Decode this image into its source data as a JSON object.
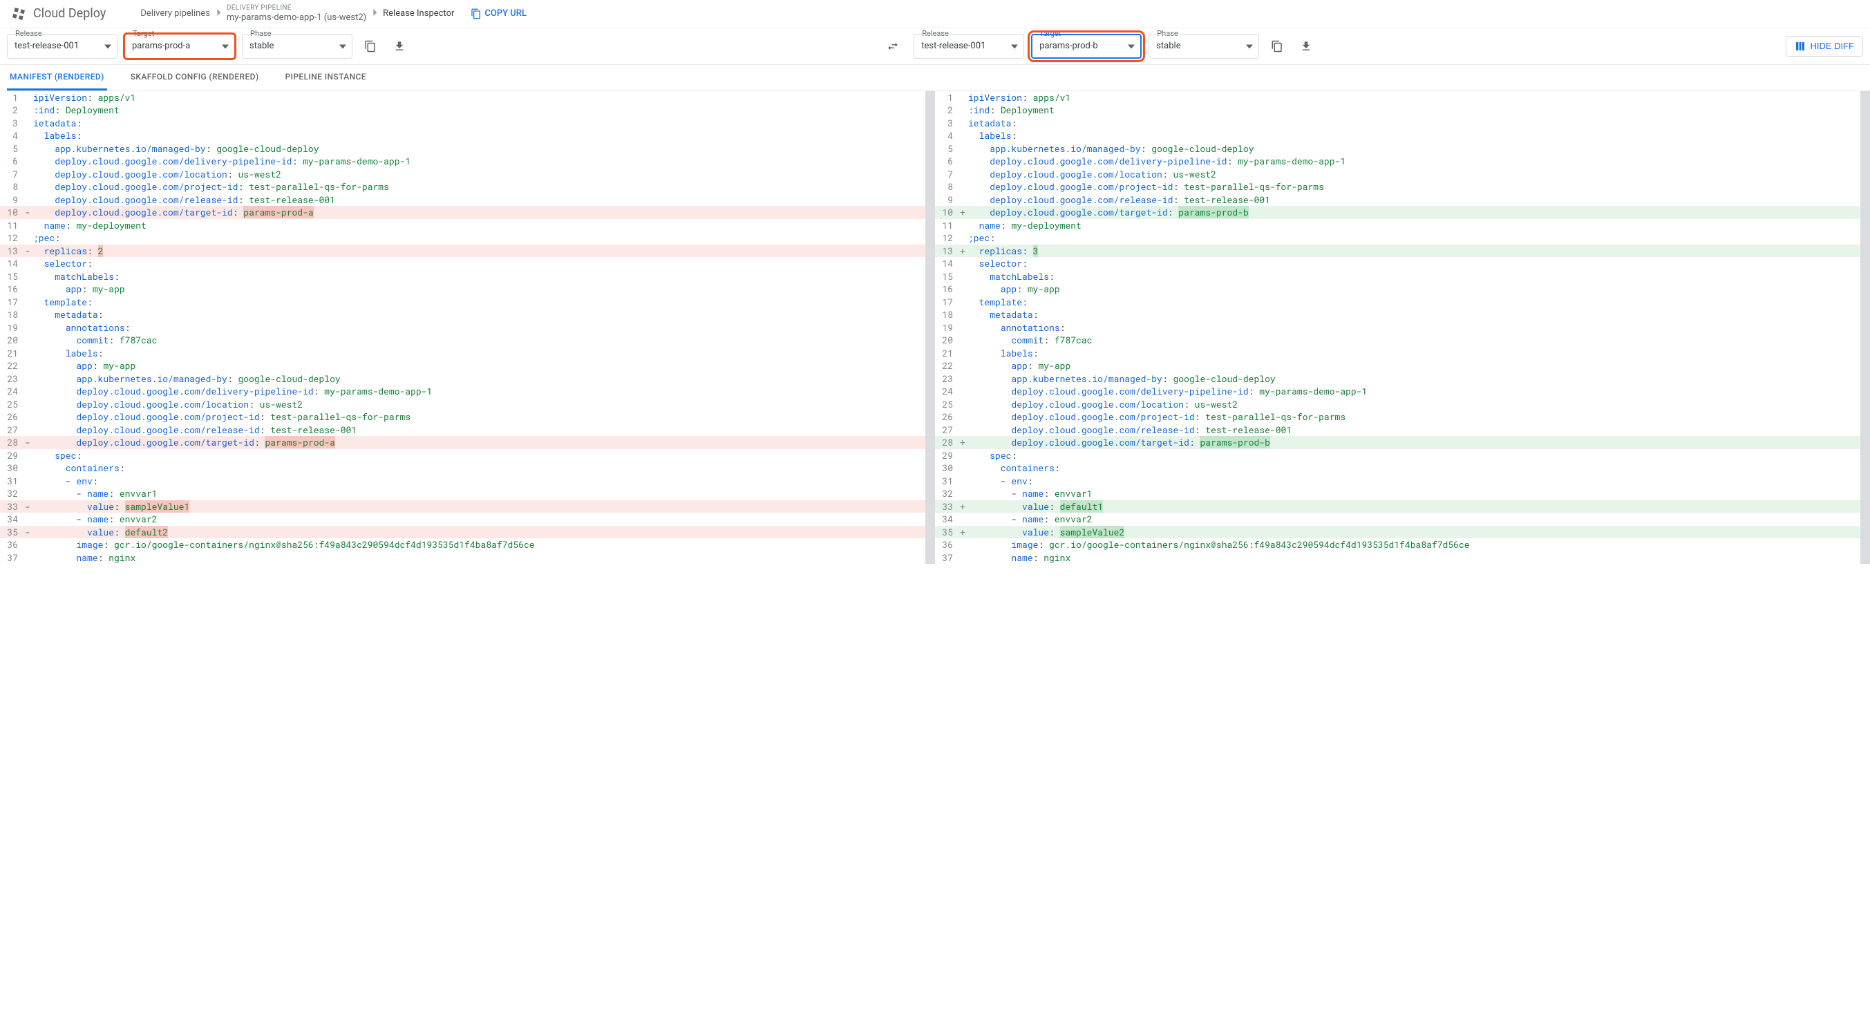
{
  "app": {
    "title": "Cloud Deploy"
  },
  "breadcrumb": {
    "root": "Delivery pipelines",
    "pipeline_label": "DELIVERY PIPELINE",
    "pipeline_value": "my-params-demo-app-1 (us-west2)",
    "current": "Release Inspector",
    "copy_url": "COPY URL"
  },
  "left_controls": {
    "release_label": "Release",
    "release_value": "test-release-001",
    "target_label": "Target",
    "target_value": "params-prod-a",
    "phase_label": "Phase",
    "phase_value": "stable"
  },
  "right_controls": {
    "release_label": "Release",
    "release_value": "test-release-001",
    "target_label": "Target",
    "target_value": "params-prod-b",
    "phase_label": "Phase",
    "phase_value": "stable"
  },
  "hide_diff_label": "HIDE DIFF",
  "tabs": {
    "manifest": "MANIFEST (RENDERED)",
    "skaffold": "SKAFFOLD CONFIG (RENDERED)",
    "pipeline": "PIPELINE INSTANCE"
  },
  "left_code": [
    {
      "n": 1,
      "t": "ipiVersion: apps/v1",
      "k": [
        "ipiVersion"
      ],
      "s": [
        "apps/v1"
      ]
    },
    {
      "n": 2,
      "t": ":ind: Deployment",
      "k": [
        ":ind"
      ],
      "s": [
        "Deployment"
      ]
    },
    {
      "n": 3,
      "t": "ietadata:",
      "k": [
        "ietadata"
      ]
    },
    {
      "n": 4,
      "t": "  labels:",
      "k": [
        "labels"
      ]
    },
    {
      "n": 5,
      "t": "    app.kubernetes.io/managed-by: google-cloud-deploy",
      "k": [
        "app.kubernetes.io/managed-by"
      ],
      "s": [
        "google-cloud-deploy"
      ]
    },
    {
      "n": 6,
      "t": "    deploy.cloud.google.com/delivery-pipeline-id: my-params-demo-app-1",
      "k": [
        "deploy.cloud.google.com/delivery-pipeline-id"
      ],
      "s": [
        "my-params-demo-app-1"
      ]
    },
    {
      "n": 7,
      "t": "    deploy.cloud.google.com/location: us-west2",
      "k": [
        "deploy.cloud.google.com/location"
      ],
      "s": [
        "us-west2"
      ]
    },
    {
      "n": 8,
      "t": "    deploy.cloud.google.com/project-id: test-parallel-qs-for-parms",
      "k": [
        "deploy.cloud.google.com/project-id"
      ],
      "s": [
        "test-parallel-qs-for-parms"
      ]
    },
    {
      "n": 9,
      "t": "    deploy.cloud.google.com/release-id: test-release-001",
      "k": [
        "deploy.cloud.google.com/release-id"
      ],
      "s": [
        "test-release-001"
      ]
    },
    {
      "n": 10,
      "mark": "-",
      "diff": "del",
      "t": "    deploy.cloud.google.com/target-id: ",
      "k": [
        "deploy.cloud.google.com/target-id"
      ],
      "tail": "params-prod-a",
      "tail_hl": "del"
    },
    {
      "n": 11,
      "t": "  name: my-deployment",
      "k": [
        "name"
      ],
      "s": [
        "my-deployment"
      ]
    },
    {
      "n": 12,
      "t": ";pec:",
      "k": [
        ";pec"
      ]
    },
    {
      "n": 13,
      "mark": "-",
      "diff": "del",
      "t": "  replicas: ",
      "k": [
        "replicas"
      ],
      "tail": "2",
      "tail_hl": "del"
    },
    {
      "n": 14,
      "t": "  selector:",
      "k": [
        "selector"
      ]
    },
    {
      "n": 15,
      "t": "    matchLabels:",
      "k": [
        "matchLabels"
      ]
    },
    {
      "n": 16,
      "t": "      app: my-app",
      "k": [
        "app"
      ],
      "s": [
        "my-app"
      ]
    },
    {
      "n": 17,
      "t": "  template:",
      "k": [
        "template"
      ]
    },
    {
      "n": 18,
      "t": "    metadata:",
      "k": [
        "metadata"
      ]
    },
    {
      "n": 19,
      "t": "      annotations:",
      "k": [
        "annotations"
      ]
    },
    {
      "n": 20,
      "t": "        commit: f787cac",
      "k": [
        "commit"
      ],
      "s": [
        "f787cac"
      ]
    },
    {
      "n": 21,
      "t": "      labels:",
      "k": [
        "labels"
      ]
    },
    {
      "n": 22,
      "t": "        app: my-app",
      "k": [
        "app"
      ],
      "s": [
        "my-app"
      ]
    },
    {
      "n": 23,
      "t": "        app.kubernetes.io/managed-by: google-cloud-deploy",
      "k": [
        "app.kubernetes.io/managed-by"
      ],
      "s": [
        "google-cloud-deploy"
      ]
    },
    {
      "n": 24,
      "t": "        deploy.cloud.google.com/delivery-pipeline-id: my-params-demo-app-1",
      "k": [
        "deploy.cloud.google.com/delivery-pipeline-id"
      ],
      "s": [
        "my-params-demo-app-1"
      ]
    },
    {
      "n": 25,
      "t": "        deploy.cloud.google.com/location: us-west2",
      "k": [
        "deploy.cloud.google.com/location"
      ],
      "s": [
        "us-west2"
      ]
    },
    {
      "n": 26,
      "t": "        deploy.cloud.google.com/project-id: test-parallel-qs-for-parms",
      "k": [
        "deploy.cloud.google.com/project-id"
      ],
      "s": [
        "test-parallel-qs-for-parms"
      ]
    },
    {
      "n": 27,
      "t": "        deploy.cloud.google.com/release-id: test-release-001",
      "k": [
        "deploy.cloud.google.com/release-id"
      ],
      "s": [
        "test-release-001"
      ]
    },
    {
      "n": 28,
      "mark": "-",
      "diff": "del",
      "t": "        deploy.cloud.google.com/target-id: ",
      "k": [
        "deploy.cloud.google.com/target-id"
      ],
      "tail": "params-prod-a",
      "tail_hl": "del"
    },
    {
      "n": 29,
      "t": "    spec:",
      "k": [
        "spec"
      ]
    },
    {
      "n": 30,
      "t": "      containers:",
      "k": [
        "containers"
      ]
    },
    {
      "n": 31,
      "t": "      - env:",
      "k": [
        "env"
      ]
    },
    {
      "n": 32,
      "t": "        - name: envvar1",
      "k": [
        "name"
      ],
      "s": [
        "envvar1"
      ]
    },
    {
      "n": 33,
      "mark": "-",
      "diff": "del",
      "t": "          value: ",
      "k": [
        "value"
      ],
      "tail": "sampleValue1",
      "tail_hl": "del"
    },
    {
      "n": 34,
      "t": "        - name: envvar2",
      "k": [
        "name"
      ],
      "s": [
        "envvar2"
      ]
    },
    {
      "n": 35,
      "mark": "-",
      "diff": "del",
      "t": "          value: ",
      "k": [
        "value"
      ],
      "tail": "default2",
      "tail_hl": "del"
    },
    {
      "n": 36,
      "t": "        image: gcr.io/google-containers/nginx@sha256:f49a843c290594dcf4d193535d1f4ba8af7d56ce",
      "k": [
        "image"
      ],
      "s": [
        "gcr.io/google-containers/nginx@sha256:f49a843c290594dcf4d193535d1f4ba8af7d56ce"
      ]
    },
    {
      "n": 37,
      "t": "        name: nginx",
      "k": [
        "name"
      ],
      "s": [
        "nginx"
      ]
    }
  ],
  "right_code": [
    {
      "n": 1,
      "t": "ipiVersion: apps/v1",
      "k": [
        "ipiVersion"
      ],
      "s": [
        "apps/v1"
      ]
    },
    {
      "n": 2,
      "t": ":ind: Deployment",
      "k": [
        ":ind"
      ],
      "s": [
        "Deployment"
      ]
    },
    {
      "n": 3,
      "t": "ietadata:",
      "k": [
        "ietadata"
      ]
    },
    {
      "n": 4,
      "t": "  labels:",
      "k": [
        "labels"
      ]
    },
    {
      "n": 5,
      "t": "    app.kubernetes.io/managed-by: google-cloud-deploy",
      "k": [
        "app.kubernetes.io/managed-by"
      ],
      "s": [
        "google-cloud-deploy"
      ]
    },
    {
      "n": 6,
      "t": "    deploy.cloud.google.com/delivery-pipeline-id: my-params-demo-app-1",
      "k": [
        "deploy.cloud.google.com/delivery-pipeline-id"
      ],
      "s": [
        "my-params-demo-app-1"
      ]
    },
    {
      "n": 7,
      "t": "    deploy.cloud.google.com/location: us-west2",
      "k": [
        "deploy.cloud.google.com/location"
      ],
      "s": [
        "us-west2"
      ]
    },
    {
      "n": 8,
      "t": "    deploy.cloud.google.com/project-id: test-parallel-qs-for-parms",
      "k": [
        "deploy.cloud.google.com/project-id"
      ],
      "s": [
        "test-parallel-qs-for-parms"
      ]
    },
    {
      "n": 9,
      "t": "    deploy.cloud.google.com/release-id: test-release-001",
      "k": [
        "deploy.cloud.google.com/release-id"
      ],
      "s": [
        "test-release-001"
      ]
    },
    {
      "n": 10,
      "mark": "+",
      "diff": "add",
      "t": "    deploy.cloud.google.com/target-id: ",
      "k": [
        "deploy.cloud.google.com/target-id"
      ],
      "tail": "params-prod-b",
      "tail_hl": "add"
    },
    {
      "n": 11,
      "t": "  name: my-deployment",
      "k": [
        "name"
      ],
      "s": [
        "my-deployment"
      ]
    },
    {
      "n": 12,
      "t": ";pec:",
      "k": [
        ";pec"
      ]
    },
    {
      "n": 13,
      "mark": "+",
      "diff": "add",
      "t": "  replicas: ",
      "k": [
        "replicas"
      ],
      "tail": "3",
      "tail_hl": "add"
    },
    {
      "n": 14,
      "t": "  selector:",
      "k": [
        "selector"
      ]
    },
    {
      "n": 15,
      "t": "    matchLabels:",
      "k": [
        "matchLabels"
      ]
    },
    {
      "n": 16,
      "t": "      app: my-app",
      "k": [
        "app"
      ],
      "s": [
        "my-app"
      ]
    },
    {
      "n": 17,
      "t": "  template:",
      "k": [
        "template"
      ]
    },
    {
      "n": 18,
      "t": "    metadata:",
      "k": [
        "metadata"
      ]
    },
    {
      "n": 19,
      "t": "      annotations:",
      "k": [
        "annotations"
      ]
    },
    {
      "n": 20,
      "t": "        commit: f787cac",
      "k": [
        "commit"
      ],
      "s": [
        "f787cac"
      ]
    },
    {
      "n": 21,
      "t": "      labels:",
      "k": [
        "labels"
      ]
    },
    {
      "n": 22,
      "t": "        app: my-app",
      "k": [
        "app"
      ],
      "s": [
        "my-app"
      ]
    },
    {
      "n": 23,
      "t": "        app.kubernetes.io/managed-by: google-cloud-deploy",
      "k": [
        "app.kubernetes.io/managed-by"
      ],
      "s": [
        "google-cloud-deploy"
      ]
    },
    {
      "n": 24,
      "t": "        deploy.cloud.google.com/delivery-pipeline-id: my-params-demo-app-1",
      "k": [
        "deploy.cloud.google.com/delivery-pipeline-id"
      ],
      "s": [
        "my-params-demo-app-1"
      ]
    },
    {
      "n": 25,
      "t": "        deploy.cloud.google.com/location: us-west2",
      "k": [
        "deploy.cloud.google.com/location"
      ],
      "s": [
        "us-west2"
      ]
    },
    {
      "n": 26,
      "t": "        deploy.cloud.google.com/project-id: test-parallel-qs-for-parms",
      "k": [
        "deploy.cloud.google.com/project-id"
      ],
      "s": [
        "test-parallel-qs-for-parms"
      ]
    },
    {
      "n": 27,
      "t": "        deploy.cloud.google.com/release-id: test-release-001",
      "k": [
        "deploy.cloud.google.com/release-id"
      ],
      "s": [
        "test-release-001"
      ]
    },
    {
      "n": 28,
      "mark": "+",
      "diff": "add",
      "t": "        deploy.cloud.google.com/target-id: ",
      "k": [
        "deploy.cloud.google.com/target-id"
      ],
      "tail": "params-prod-b",
      "tail_hl": "add"
    },
    {
      "n": 29,
      "t": "    spec:",
      "k": [
        "spec"
      ]
    },
    {
      "n": 30,
      "t": "      containers:",
      "k": [
        "containers"
      ]
    },
    {
      "n": 31,
      "t": "      - env:",
      "k": [
        "env"
      ]
    },
    {
      "n": 32,
      "t": "        - name: envvar1",
      "k": [
        "name"
      ],
      "s": [
        "envvar1"
      ]
    },
    {
      "n": 33,
      "mark": "+",
      "diff": "add",
      "t": "          value: ",
      "k": [
        "value"
      ],
      "tail": "default1",
      "tail_hl": "add"
    },
    {
      "n": 34,
      "t": "        - name: envvar2",
      "k": [
        "name"
      ],
      "s": [
        "envvar2"
      ]
    },
    {
      "n": 35,
      "mark": "+",
      "diff": "add",
      "t": "          value: ",
      "k": [
        "value"
      ],
      "tail": "sampleValue2",
      "tail_hl": "add"
    },
    {
      "n": 36,
      "t": "        image: gcr.io/google-containers/nginx@sha256:f49a843c290594dcf4d193535d1f4ba8af7d56ce",
      "k": [
        "image"
      ],
      "s": [
        "gcr.io/google-containers/nginx@sha256:f49a843c290594dcf4d193535d1f4ba8af7d56ce"
      ]
    },
    {
      "n": 37,
      "t": "        name: nginx",
      "k": [
        "name"
      ],
      "s": [
        "nginx"
      ]
    }
  ]
}
